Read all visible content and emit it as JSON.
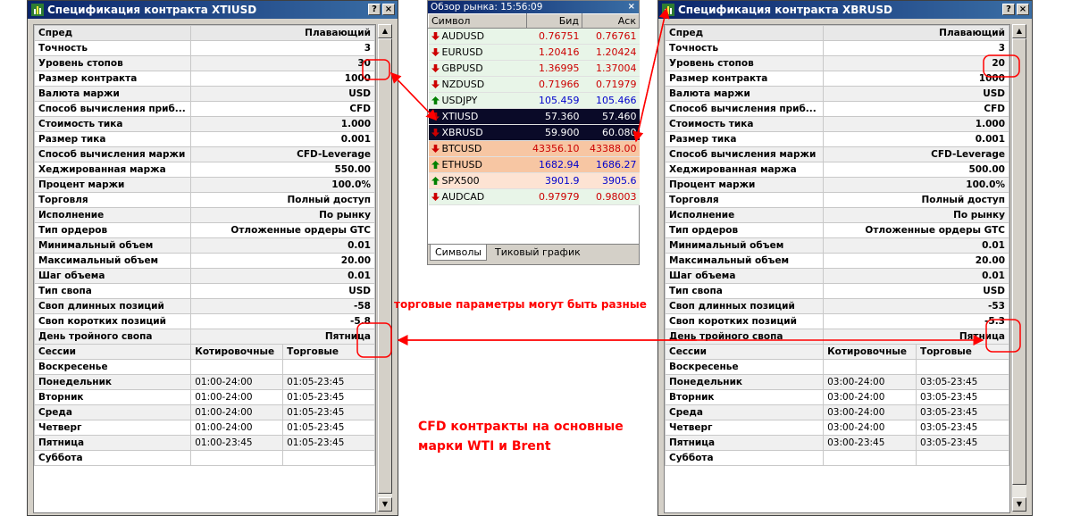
{
  "left_window": {
    "title": "Спецификация контракта XTIUSD",
    "help_label": "?",
    "close_label": "×",
    "rows": [
      [
        "Спред",
        "Плавающий"
      ],
      [
        "Точность",
        "3"
      ],
      [
        "Уровень стопов",
        "30"
      ],
      [
        "Размер контракта",
        "1000"
      ],
      [
        "Валюта маржи",
        "USD"
      ],
      [
        "Способ вычисления приб...",
        "CFD"
      ],
      [
        "Стоимость тика",
        "1.000"
      ],
      [
        "Размер тика",
        "0.001"
      ],
      [
        "Способ вычисления маржи",
        "CFD-Leverage"
      ],
      [
        "Хеджированная маржа",
        "550.00"
      ],
      [
        "Процент маржи",
        "100.0%"
      ],
      [
        "Торговля",
        "Полный доступ"
      ],
      [
        "Исполнение",
        "По рынку"
      ],
      [
        "Тип ордеров",
        "Отложенные ордеры GTC"
      ],
      [
        "Минимальный объем",
        "0.01"
      ],
      [
        "Максимальный объем",
        "20.00"
      ],
      [
        "Шаг объема",
        "0.01"
      ],
      [
        "Тип свопа",
        "USD"
      ],
      [
        "Своп длинных позиций",
        "-58"
      ],
      [
        "Своп коротких позиций",
        "-5.8"
      ],
      [
        "День тройного свопа",
        "Пятница"
      ]
    ],
    "sessions_header": [
      "Сессии",
      "Котировочные",
      "Торговые"
    ],
    "sessions": [
      [
        "Воскресенье",
        "",
        ""
      ],
      [
        "Понедельник",
        "01:00-24:00",
        "01:05-23:45"
      ],
      [
        "Вторник",
        "01:00-24:00",
        "01:05-23:45"
      ],
      [
        "Среда",
        "01:00-24:00",
        "01:05-23:45"
      ],
      [
        "Четверг",
        "01:00-24:00",
        "01:05-23:45"
      ],
      [
        "Пятница",
        "01:00-23:45",
        "01:05-23:45"
      ],
      [
        "Суббота",
        "",
        ""
      ]
    ]
  },
  "right_window": {
    "title": "Спецификация контракта XBRUSD",
    "help_label": "?",
    "close_label": "×",
    "rows": [
      [
        "Спред",
        "Плавающий"
      ],
      [
        "Точность",
        "3"
      ],
      [
        "Уровень стопов",
        "20"
      ],
      [
        "Размер контракта",
        "1000"
      ],
      [
        "Валюта маржи",
        "USD"
      ],
      [
        "Способ вычисления приб...",
        "CFD"
      ],
      [
        "Стоимость тика",
        "1.000"
      ],
      [
        "Размер тика",
        "0.001"
      ],
      [
        "Способ вычисления маржи",
        "CFD-Leverage"
      ],
      [
        "Хеджированная маржа",
        "500.00"
      ],
      [
        "Процент маржи",
        "100.0%"
      ],
      [
        "Торговля",
        "Полный доступ"
      ],
      [
        "Исполнение",
        "По рынку"
      ],
      [
        "Тип ордеров",
        "Отложенные ордеры GTC"
      ],
      [
        "Минимальный объем",
        "0.01"
      ],
      [
        "Максимальный объем",
        "20.00"
      ],
      [
        "Шаг объема",
        "0.01"
      ],
      [
        "Тип свопа",
        "USD"
      ],
      [
        "Своп длинных позиций",
        "-53"
      ],
      [
        "Своп коротких позиций",
        "-5.3"
      ],
      [
        "День тройного свопа",
        "Пятница"
      ]
    ],
    "sessions_header": [
      "Сессии",
      "Котировочные",
      "Торговые"
    ],
    "sessions": [
      [
        "Воскресенье",
        "",
        ""
      ],
      [
        "Понедельник",
        "03:00-24:00",
        "03:05-23:45"
      ],
      [
        "Вторник",
        "03:00-24:00",
        "03:05-23:45"
      ],
      [
        "Среда",
        "03:00-24:00",
        "03:05-23:45"
      ],
      [
        "Четверг",
        "03:00-24:00",
        "03:05-23:45"
      ],
      [
        "Пятница",
        "03:00-23:45",
        "03:05-23:45"
      ],
      [
        "Суббота",
        "",
        ""
      ]
    ]
  },
  "market_watch": {
    "title": "Обзор рынка: 15:56:09",
    "close_label": "×",
    "columns": [
      "Символ",
      "Бид",
      "Аск"
    ],
    "rows": [
      {
        "symbol": "AUDUSD",
        "bid": "0.76751",
        "ask": "0.76761",
        "dir": "down",
        "style": "plain"
      },
      {
        "symbol": "EURUSD",
        "bid": "1.20416",
        "ask": "1.20424",
        "dir": "down",
        "style": "plain"
      },
      {
        "symbol": "GBPUSD",
        "bid": "1.36995",
        "ask": "1.37004",
        "dir": "down",
        "style": "plain"
      },
      {
        "symbol": "NZDUSD",
        "bid": "0.71966",
        "ask": "0.71979",
        "dir": "down",
        "style": "plain"
      },
      {
        "symbol": "USDJPY",
        "bid": "105.459",
        "ask": "105.466",
        "dir": "up",
        "style": "plain"
      },
      {
        "symbol": "XTIUSD",
        "bid": "57.360",
        "ask": "57.460",
        "dir": "down",
        "style": "dark"
      },
      {
        "symbol": "XBRUSD",
        "bid": "59.900",
        "ask": "60.080",
        "dir": "down",
        "style": "dark"
      },
      {
        "symbol": "BTCUSD",
        "bid": "43356.10",
        "ask": "43388.00",
        "dir": "down",
        "style": "orange"
      },
      {
        "symbol": "ETHUSD",
        "bid": "1682.94",
        "ask": "1686.27",
        "dir": "up",
        "style": "orange"
      },
      {
        "symbol": "SPX500",
        "bid": "3901.9",
        "ask": "3905.6",
        "dir": "up",
        "style": "light"
      },
      {
        "symbol": "AUDCAD",
        "bid": "0.97979",
        "ask": "0.98003",
        "dir": "down",
        "style": "plain"
      }
    ],
    "tabs": [
      "Символы",
      "Тиковый график"
    ]
  },
  "annotations": {
    "note1": "торговые параметры могут быть разные",
    "note2_line1": "CFD контракты на основные",
    "note2_line2": "марки WTI и Brent"
  },
  "colors": {
    "annotation": "#ff0000",
    "up": "#008000",
    "down": "#cc0000",
    "dark_row": "#0a0a28",
    "orange_row": "#f7c6a3",
    "light_row": "#fde3d3",
    "plain_row": "#e8f5e8"
  }
}
